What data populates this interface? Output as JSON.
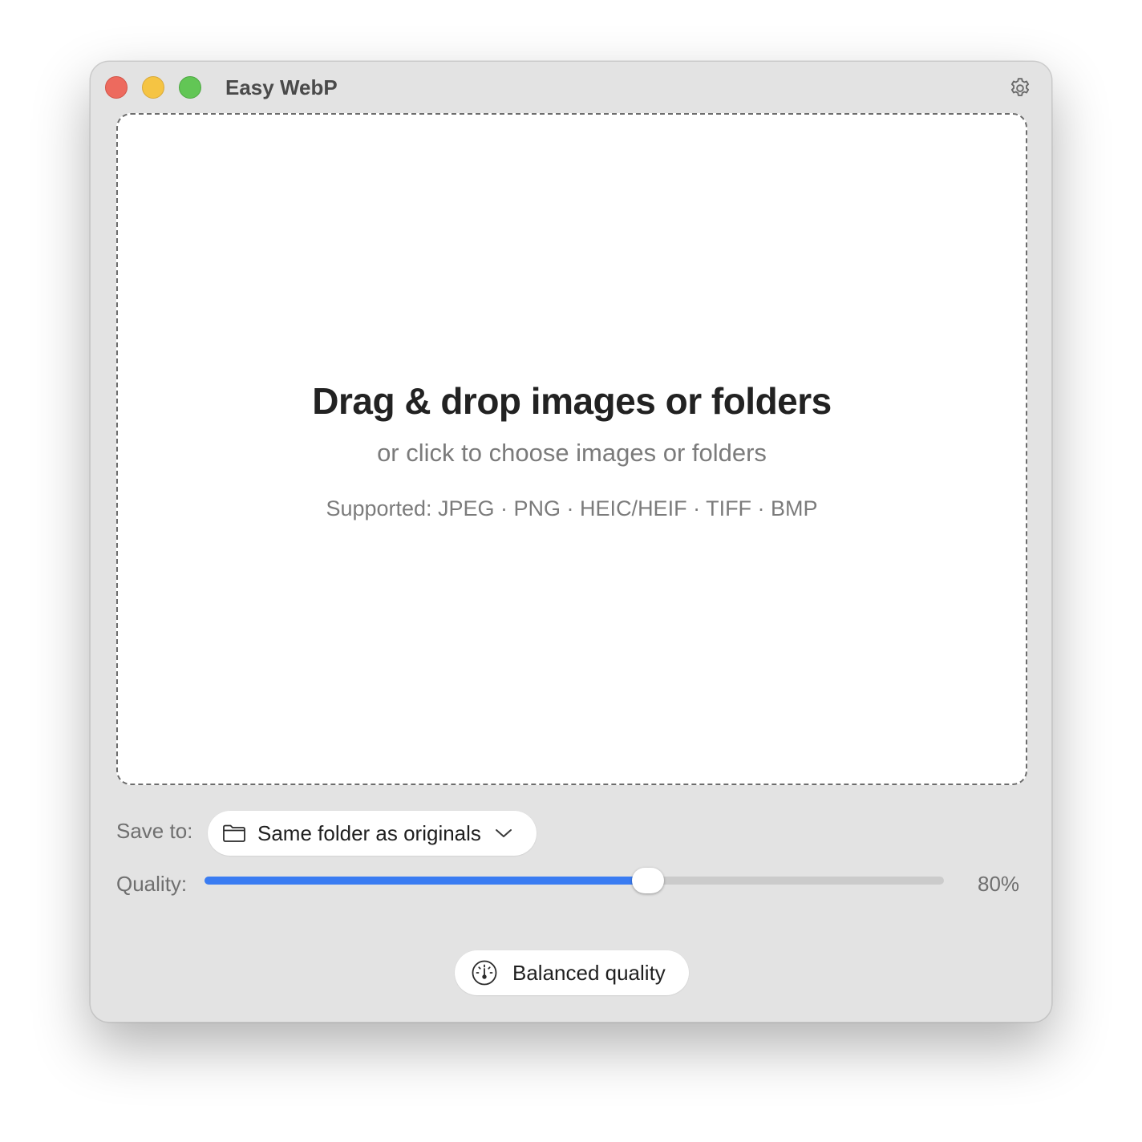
{
  "window": {
    "title": "Easy WebP",
    "controls": [
      "close",
      "minimize",
      "zoom"
    ],
    "settings_icon": "gear-icon"
  },
  "dropzone": {
    "title": "Drag & drop images or folders",
    "subtitle": "or click to choose images or folders",
    "supported": "Supported: JPEG · PNG · HEIC/HEIF · TIFF · BMP"
  },
  "save": {
    "label": "Save to:",
    "value": "Same folder as originals",
    "icon": "folder-icon"
  },
  "quality": {
    "label": "Quality:",
    "value": 80,
    "value_text": "80%",
    "fill_fraction": 0.6
  },
  "preset": {
    "label": "Balanced quality",
    "icon": "gauge-icon"
  },
  "colors": {
    "accent": "#3a7cf2",
    "close": "#ed6a5e",
    "minimize": "#f5c443",
    "zoom": "#62c655"
  }
}
